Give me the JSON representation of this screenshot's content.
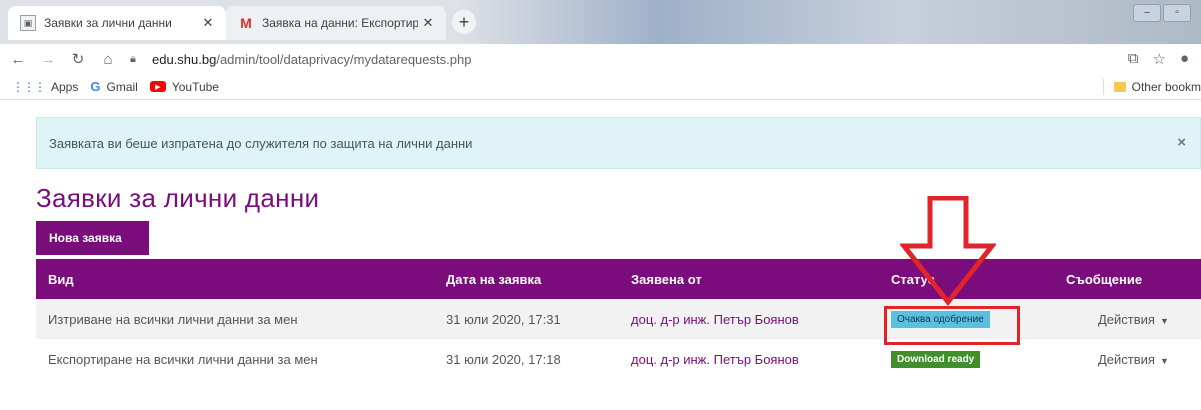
{
  "browser": {
    "tabs": [
      {
        "title": "Заявки за лични данни",
        "favicon": "page-icon",
        "active": true
      },
      {
        "title": "Заявка на данни: Експортиране",
        "favicon": "gmail-icon",
        "active": false
      }
    ],
    "url_domain": "edu.shu.bg",
    "url_path": "/admin/tool/dataprivacy/mydatarequests.php",
    "bookmarks": [
      {
        "label": "Apps",
        "icon": "apps-icon"
      },
      {
        "label": "Gmail",
        "icon": "google-icon"
      },
      {
        "label": "YouTube",
        "icon": "youtube-icon"
      }
    ],
    "other_bookmarks": "Other bookm"
  },
  "alert": {
    "message": "Заявката ви беше изпратена до служителя по защита на лични данни",
    "close": "×"
  },
  "page": {
    "title": "Заявки за лични данни",
    "new_request": "Нова заявка"
  },
  "table": {
    "headers": [
      "Вид",
      "Дата на заявка",
      "Заявена от",
      "Статус",
      "Съобщение"
    ],
    "rows": [
      {
        "type": "Изтриване на всички лични данни за мен",
        "date": "31 юли 2020, 17:31",
        "requested_by": "доц. д-р инж. Петър Боянов",
        "status": "Очаква одобрение",
        "status_kind": "info",
        "actions": "Действия"
      },
      {
        "type": "Експортиране на всички лични данни за мен",
        "date": "31 юли 2020, 17:18",
        "requested_by": "доц. д-р инж. Петър Боянов",
        "status": "Download ready",
        "status_kind": "success",
        "actions": "Действия"
      }
    ]
  },
  "colors": {
    "brand": "#7a0d7b",
    "annotation": "#e0242a",
    "info_badge": "#5bc0de",
    "success_badge": "#3f8f2a"
  }
}
